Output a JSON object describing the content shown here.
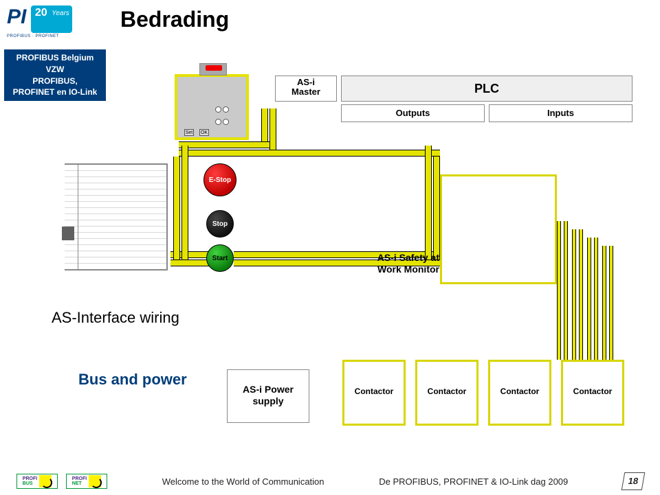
{
  "title": "Bedrading",
  "logo": {
    "pi": "PI",
    "badge_num": "20",
    "badge_txt": "Years",
    "subtitle": "PROFIBUS · PROFINET"
  },
  "org": {
    "line1": "PROFIBUS Belgium",
    "line2": "VZW",
    "line3": "PROFIBUS,",
    "line4": "PROFINET en IO-Link"
  },
  "plc": {
    "master_l1": "AS-i",
    "master_l2": "Master",
    "plc": "PLC",
    "outputs": "Outputs",
    "inputs": "Inputs"
  },
  "device": {
    "set": "Set",
    "ok": "OK"
  },
  "buttons": {
    "estop": "E-Stop",
    "stop": "Stop",
    "start": "Start"
  },
  "monitor": {
    "l1": "AS-i Safety at",
    "l2": "Work Monitor"
  },
  "labels": {
    "wiring": "AS-Interface wiring",
    "bus": "Bus and power"
  },
  "psu": {
    "l1": "AS-i Power",
    "l2": "supply"
  },
  "contactors": [
    "Contactor",
    "Contactor",
    "Contactor",
    "Contactor"
  ],
  "footer": {
    "logo_stack1": "PROFI",
    "logo_stack2a": "BUS",
    "logo_stack2b": "NET",
    "left": "Welcome to the World of Communication",
    "right": "De PROFIBUS, PROFINET & IO-Link dag 2009",
    "page": "18"
  }
}
